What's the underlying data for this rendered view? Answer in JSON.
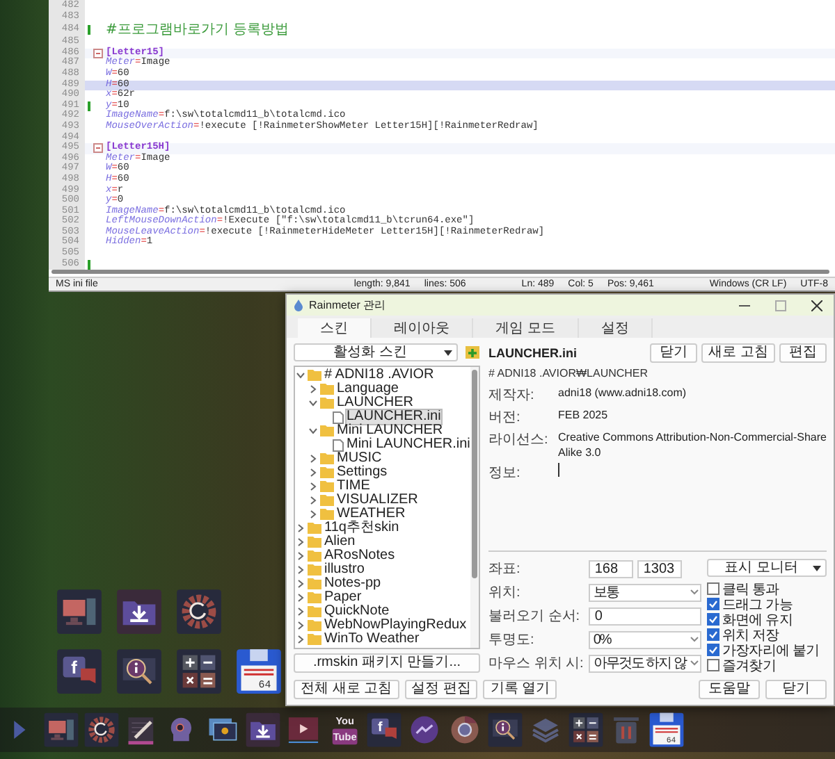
{
  "editor": {
    "lines": [
      {
        "number": "482",
        "kind": "blank",
        "changed": false,
        "selected": false
      },
      {
        "number": "483",
        "kind": "blank",
        "changed": false,
        "selected": false
      },
      {
        "number": "484",
        "kind": "comment",
        "text": "#프로그램바로가기 등록방법",
        "changed": true,
        "selected": false
      },
      {
        "number": "485",
        "kind": "blank",
        "changed": false,
        "selected": false
      },
      {
        "number": "486",
        "kind": "section",
        "text": "[Letter15]",
        "changed": false,
        "selected": false
      },
      {
        "number": "487",
        "kind": "pair",
        "key": "Meter",
        "sep": "=",
        "value": "Image",
        "changed": false,
        "selected": false
      },
      {
        "number": "488",
        "kind": "pair",
        "key": "W",
        "sep": "=",
        "value": "60",
        "changed": false,
        "selected": false
      },
      {
        "number": "489",
        "kind": "pair",
        "key": "H",
        "sep": "=",
        "value": "60",
        "changed": false,
        "selected": true
      },
      {
        "number": "490",
        "kind": "pair",
        "key": "x",
        "sep": "=",
        "value": "62r",
        "changed": false,
        "selected": false
      },
      {
        "number": "491",
        "kind": "pair",
        "key": "y",
        "sep": "=",
        "value": "10",
        "changed": true,
        "selected": false
      },
      {
        "number": "492",
        "kind": "pair",
        "key": "ImageName",
        "sep": "=",
        "value": "f:\\sw\\totalcmd11_b\\totalcmd.ico",
        "changed": false,
        "selected": false
      },
      {
        "number": "493",
        "kind": "pair",
        "key": "MouseOverAction",
        "sep": "=",
        "value": "!execute [!RainmeterShowMeter Letter15H][!RainmeterRedraw]",
        "changed": false,
        "selected": false
      },
      {
        "number": "494",
        "kind": "blank",
        "changed": false,
        "selected": false
      },
      {
        "number": "495",
        "kind": "section",
        "text": "[Letter15H]",
        "changed": false,
        "selected": false
      },
      {
        "number": "496",
        "kind": "pair",
        "key": "Meter",
        "sep": "=",
        "value": "Image",
        "changed": false,
        "selected": false
      },
      {
        "number": "497",
        "kind": "pair",
        "key": "W",
        "sep": "=",
        "value": "60",
        "changed": false,
        "selected": false
      },
      {
        "number": "498",
        "kind": "pair",
        "key": "H",
        "sep": "=",
        "value": "60",
        "changed": false,
        "selected": false
      },
      {
        "number": "499",
        "kind": "pair",
        "key": "x",
        "sep": "=",
        "value": "r",
        "changed": false,
        "selected": false
      },
      {
        "number": "500",
        "kind": "pair",
        "key": "y",
        "sep": "=",
        "value": "0",
        "changed": false,
        "selected": false
      },
      {
        "number": "501",
        "kind": "pair",
        "key": "ImageName",
        "sep": "=",
        "value": "f:\\sw\\totalcmd11_b\\totalcmd.ico",
        "changed": false,
        "selected": false
      },
      {
        "number": "502",
        "kind": "pair",
        "key": "LeftMouseDownAction",
        "sep": "=",
        "value": "!Execute [\"f:\\sw\\totalcmd11_b\\tcrun64.exe\"]",
        "changed": false,
        "selected": false
      },
      {
        "number": "503",
        "kind": "pair",
        "key": "MouseLeaveAction",
        "sep": "=",
        "value": "!execute [!RainmeterHideMeter Letter15H][!RainmeterRedraw]",
        "changed": false,
        "selected": false
      },
      {
        "number": "504",
        "kind": "pair",
        "key": "Hidden",
        "sep": "=",
        "value": "1",
        "changed": false,
        "selected": false
      },
      {
        "number": "505",
        "kind": "blank",
        "changed": false,
        "selected": false
      },
      {
        "number": "506",
        "kind": "blank",
        "changed": true,
        "selected": false
      }
    ],
    "status_bar": [
      "MS ini file",
      "length: 9,841",
      "lines: 506",
      "Ln: 489",
      "Col: 5",
      "Pos: 9,461",
      "Windows (CR LF)",
      "UTF-8"
    ]
  },
  "dialog": {
    "title": "Rainmeter 관리",
    "tabs": [
      {
        "label": "스킨",
        "selected": true
      },
      {
        "label": "레이아웃",
        "selected": false
      },
      {
        "label": "게임 모드",
        "selected": false
      },
      {
        "label": "설정",
        "selected": false
      }
    ],
    "skins_dropdown": "활성화 스킨",
    "tree": [
      {
        "label": "# ADNI18 .AVIOR",
        "kind": "folder",
        "expanded": true,
        "selected": false,
        "children": [
          {
            "label": "Language",
            "kind": "folder",
            "expanded": false,
            "selected": false
          },
          {
            "label": "LAUNCHER",
            "kind": "folder",
            "expanded": true,
            "selected": false,
            "children": [
              {
                "label": "LAUNCHER.ini",
                "kind": "file",
                "selected": true
              }
            ]
          },
          {
            "label": "Mini LAUNCHER",
            "kind": "folder",
            "expanded": true,
            "selected": false,
            "children": [
              {
                "label": "Mini LAUNCHER.ini",
                "kind": "file",
                "selected": false
              }
            ]
          },
          {
            "label": "MUSIC",
            "kind": "folder",
            "expanded": false,
            "selected": false
          },
          {
            "label": "Settings",
            "kind": "folder",
            "expanded": false,
            "selected": false
          },
          {
            "label": "TIME",
            "kind": "folder",
            "expanded": false,
            "selected": false
          },
          {
            "label": "VISUALIZER",
            "kind": "folder",
            "expanded": false,
            "selected": false
          },
          {
            "label": "WEATHER",
            "kind": "folder",
            "expanded": false,
            "selected": false
          }
        ]
      },
      {
        "label": "11q추천skin",
        "kind": "folder",
        "expanded": false,
        "selected": false
      },
      {
        "label": "Alien",
        "kind": "folder",
        "expanded": false,
        "selected": false
      },
      {
        "label": "ARosNotes",
        "kind": "folder",
        "expanded": false,
        "selected": false
      },
      {
        "label": "illustro",
        "kind": "folder",
        "expanded": false,
        "selected": false
      },
      {
        "label": "Notes-pp",
        "kind": "folder",
        "expanded": false,
        "selected": false
      },
      {
        "label": "Paper",
        "kind": "folder",
        "expanded": false,
        "selected": false
      },
      {
        "label": "QuickNote",
        "kind": "folder",
        "expanded": false,
        "selected": false
      },
      {
        "label": "WebNowPlayingRedux",
        "kind": "folder",
        "expanded": false,
        "selected": false
      },
      {
        "label": "WinTo Weather",
        "kind": "folder",
        "expanded": false,
        "selected": false
      }
    ],
    "package_button": ".rmskin 패키지 만들기...",
    "skin_name": "LAUNCHER.ini",
    "skin_path": "# ADNI18 .AVIOR₩LAUNCHER",
    "header_buttons": [
      "닫기",
      "새로 고침",
      "편집"
    ],
    "info": [
      {
        "label": "제작자:",
        "value": "adni18 (www.adni18.com)"
      },
      {
        "label": "버전:",
        "value": "FEB 2025"
      },
      {
        "label": "라이선스:",
        "value": "Creative Commons Attribution-Non-Commercial-Share Alike 3.0"
      }
    ],
    "info_field": {
      "label": "정보:"
    },
    "settings": [
      {
        "label": "좌표:",
        "kind": "pair",
        "values": [
          "168",
          "1303"
        ]
      },
      {
        "label": "위치:",
        "kind": "select",
        "value": "보통"
      },
      {
        "label": "불러오기 순서:",
        "kind": "input",
        "value": "0"
      },
      {
        "label": "투명도:",
        "kind": "select",
        "value": "0%"
      },
      {
        "label": "마우스 위치 시:",
        "kind": "select",
        "value": "아무것도 하지 않"
      }
    ],
    "monitor_dropdown": "표시 모니터",
    "options": [
      {
        "label": "클릭 통과",
        "checked": false
      },
      {
        "label": "드래그 가능",
        "checked": true
      },
      {
        "label": "화면에 유지",
        "checked": true
      },
      {
        "label": "위치 저장",
        "checked": true
      },
      {
        "label": "가장자리에 붙기",
        "checked": true
      },
      {
        "label": "즐겨찾기",
        "checked": false
      }
    ],
    "footer_left": [
      "전체 새로 고침",
      "설정 편집",
      "기록 열기"
    ],
    "footer_right": [
      "도움말",
      "닫기"
    ]
  },
  "launcher_grid": [
    [
      {
        "kind": "monitor"
      },
      {
        "kind": "download"
      },
      {
        "kind": "gear"
      }
    ],
    [
      {
        "kind": "facebook",
        "label": "f"
      },
      {
        "kind": "info"
      },
      {
        "kind": "calculator"
      },
      {
        "kind": "floppy",
        "label": "64"
      }
    ]
  ],
  "dock": [
    {
      "kind": "arrow"
    },
    {
      "kind": "monitor"
    },
    {
      "kind": "gear"
    },
    {
      "kind": "pencil"
    },
    {
      "kind": "head"
    },
    {
      "kind": "photo"
    },
    {
      "kind": "download"
    },
    {
      "kind": "video"
    },
    {
      "kind": "youtube",
      "label_lines": [
        "You",
        "Tube"
      ]
    },
    {
      "kind": "facebook",
      "label": "f"
    },
    {
      "kind": "messenger"
    },
    {
      "kind": "chrome"
    },
    {
      "kind": "info"
    },
    {
      "kind": "layers"
    },
    {
      "kind": "calculator"
    },
    {
      "kind": "trash"
    },
    {
      "kind": "floppy",
      "label": "64"
    }
  ]
}
